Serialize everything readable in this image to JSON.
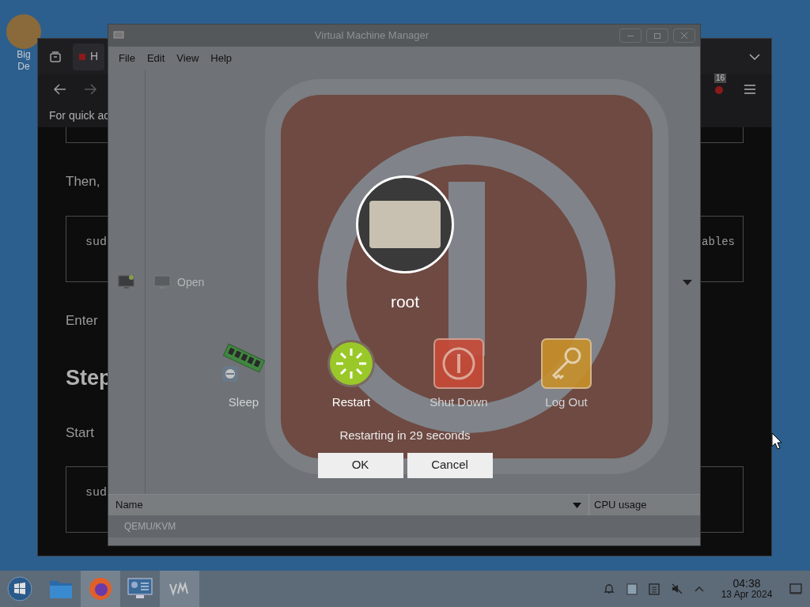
{
  "desktop": {
    "icon_label_lines": [
      "Big",
      "De"
    ]
  },
  "browser_window": {
    "tab_label": "H",
    "bookmark_hint": "For quick ac",
    "notification_count": "16",
    "content": [
      {
        "kind": "text",
        "text": "Then,"
      },
      {
        "kind": "code",
        "text": "sud",
        "right_text": "ables"
      },
      {
        "kind": "text",
        "text": "Enter"
      },
      {
        "kind": "heading",
        "text": "Step"
      },
      {
        "kind": "text",
        "text": "Start"
      },
      {
        "kind": "code",
        "text": "sud"
      }
    ]
  },
  "vmm_window": {
    "title": "Virtual Machine Manager",
    "menu": [
      "File",
      "Edit",
      "View",
      "Help"
    ],
    "toolbar_open": "Open",
    "columns": [
      "Name",
      "CPU usage"
    ],
    "rows": [
      "QEMU/KVM"
    ]
  },
  "logout_dialog": {
    "user": "root",
    "actions": [
      {
        "kind": "sleep",
        "label": "Sleep",
        "selected": false
      },
      {
        "kind": "restart",
        "label": "Restart",
        "selected": true
      },
      {
        "kind": "shutdown",
        "label": "Shut Down",
        "selected": false
      },
      {
        "kind": "logout",
        "label": "Log Out",
        "selected": false
      }
    ],
    "message": "Restarting in 29 seconds",
    "buttons": [
      "OK",
      "Cancel"
    ]
  },
  "taskbar": {
    "apps": [
      {
        "kind": "start",
        "active": false
      },
      {
        "kind": "files",
        "active": false
      },
      {
        "kind": "firefox",
        "active": true
      },
      {
        "kind": "monitor",
        "active": false
      },
      {
        "kind": "vm",
        "active": true
      }
    ],
    "time": "04:38",
    "date": "13 Apr 2024"
  }
}
